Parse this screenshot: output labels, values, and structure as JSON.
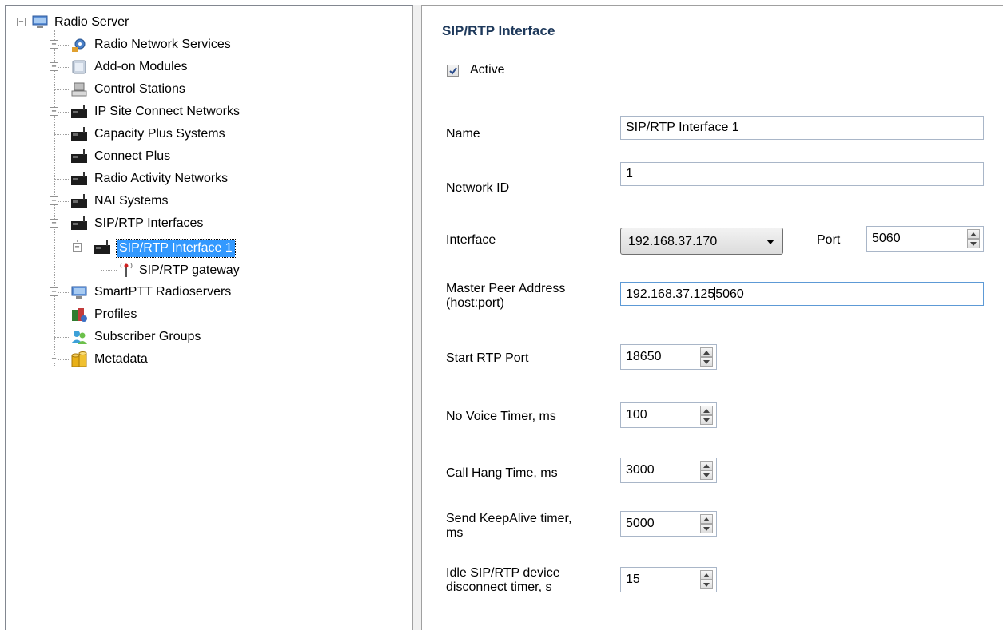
{
  "tree": {
    "root": "Radio Server",
    "items": [
      {
        "label": "Radio Network Services"
      },
      {
        "label": "Add-on Modules"
      },
      {
        "label": "Control Stations"
      },
      {
        "label": "IP Site Connect Networks"
      },
      {
        "label": "Capacity Plus Systems"
      },
      {
        "label": "Connect Plus"
      },
      {
        "label": "Radio Activity Networks"
      },
      {
        "label": "NAI Systems"
      },
      {
        "label": "SIP/RTP Interfaces"
      },
      {
        "label": "SIP/RTP Interface 1"
      },
      {
        "label": "SIP/RTP gateway"
      },
      {
        "label": "SmartPTT Radioservers"
      },
      {
        "label": "Profiles"
      },
      {
        "label": "Subscriber Groups"
      },
      {
        "label": "Metadata"
      }
    ]
  },
  "form": {
    "title": "SIP/RTP Interface",
    "active": {
      "label": "Active",
      "checked": true
    },
    "name": {
      "label": "Name",
      "value": "SIP/RTP Interface 1"
    },
    "network_id": {
      "label": "Network ID",
      "value": "1"
    },
    "interface": {
      "label": "Interface",
      "value": "192.168.37.170"
    },
    "port": {
      "label": "Port",
      "value": "5060"
    },
    "master_peer": {
      "label_line1": "Master Peer Address",
      "label_line2": "(host:port)",
      "value_before_caret": "192.168.37.125",
      "value_after_caret": "5060"
    },
    "start_rtp_port": {
      "label": "Start RTP Port",
      "value": "18650"
    },
    "no_voice_timer": {
      "label": "No Voice Timer, ms",
      "value": "100"
    },
    "call_hang_time": {
      "label": "Call Hang Time, ms",
      "value": "3000"
    },
    "keepalive": {
      "label_line1": "Send KeepAlive timer,",
      "label_line2": "ms",
      "value": "5000"
    },
    "idle_disconnect": {
      "label_line1": "Idle SIP/RTP device",
      "label_line2": "disconnect timer, s",
      "value": "15"
    }
  },
  "colors": {
    "selection": "#3399ff",
    "section_title": "#1e395b"
  }
}
